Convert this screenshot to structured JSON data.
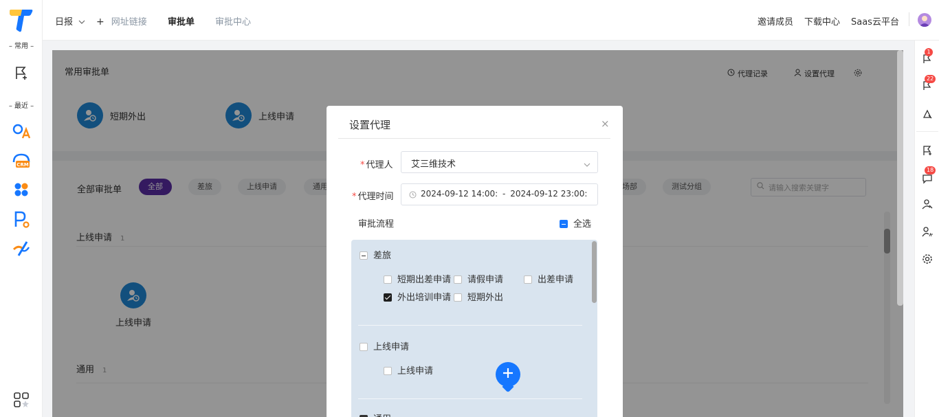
{
  "left_rail": {
    "common_label": "– 常用 –",
    "recent_label": "– 最近 –",
    "crm_text": "CRM"
  },
  "topbar": {
    "tabs": [
      "日报",
      "网址链接",
      "审批单",
      "审批中心"
    ],
    "right_links": [
      "邀请成员",
      "下载中心",
      "Saas云平台"
    ]
  },
  "page": {
    "common_title": "常用审批单",
    "proxy_record": "代理记录",
    "set_proxy": "设置代理",
    "common_items": [
      "短期外出",
      "上线申请"
    ],
    "all_label": "全部审批单",
    "pills": [
      "全部",
      "差旅",
      "上线申请",
      "通用",
      "场部",
      "测试分组"
    ],
    "search_placeholder": "请输入搜索关键字",
    "group1_title": "上线申请",
    "group1_count": "1",
    "group1_item": "上线申请",
    "group2_title": "通用",
    "group2_count": "1"
  },
  "right_rail": {
    "badges": [
      "1",
      "22",
      "18"
    ]
  },
  "modal": {
    "title": "设置代理",
    "close": "×",
    "proxy_person_label": "代理人",
    "proxy_person_value": "艾三维技术",
    "proxy_time_label": "代理时间",
    "proxy_time_start": "2024-09-12 14:00:",
    "proxy_time_sep": "-",
    "proxy_time_end": "2024-09-12 23:00:",
    "flow_label": "审批流程",
    "select_all": "全选",
    "groups": [
      {
        "name": "差旅",
        "items": [
          "短期出差申请",
          "请假申请",
          "出差申请",
          "外出培训申请",
          "短期外出"
        ]
      },
      {
        "name": "上线申请",
        "items": [
          "上线申请"
        ]
      },
      {
        "name": "通用",
        "items": []
      }
    ]
  },
  "colors": {
    "accent_blue": "#1677ff",
    "pill_active": "#5b2ea6",
    "icon_blue": "#1f88d8",
    "badge_red": "#f54a45"
  }
}
